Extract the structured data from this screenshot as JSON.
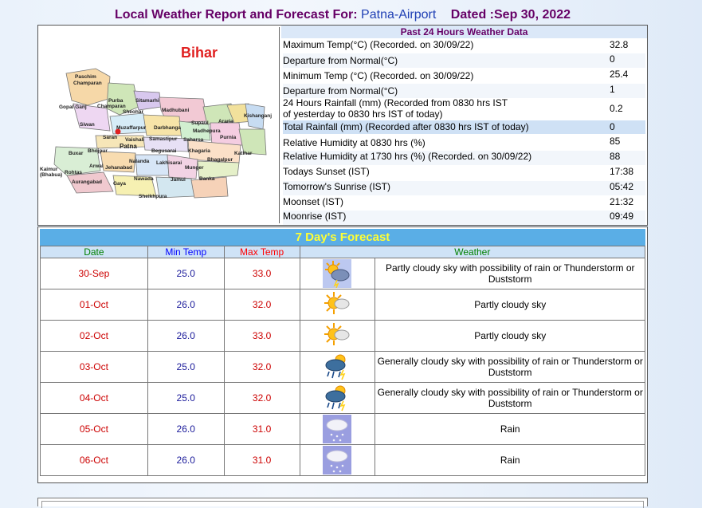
{
  "header": {
    "prefix": "Local Weather Report and Forecast For:",
    "station": "Patna-Airport",
    "dated": "Dated :Sep 30, 2022"
  },
  "map": {
    "state": "Bihar",
    "districts": [
      "Paschim Champaran",
      "Purba Champaran",
      "Sitamarhi",
      "Gopal Ganj",
      "Sheohar",
      "Madhubani",
      "Supaul",
      "Araria",
      "Kishanganj",
      "Siwan",
      "Muzaffarpur",
      "Darbhanga",
      "Madhepura",
      "Saran",
      "Vaishali",
      "Samastipur",
      "Saharsa",
      "Purnia",
      "Katihar",
      "Buxar",
      "Bhojpur",
      "Patna",
      "Begusarai",
      "Khagaria",
      "Arwal",
      "Jehanabad",
      "Nalanda",
      "Lakhisarai",
      "Munger",
      "Bhagalpur",
      "Kaimur (Bhabua)",
      "Rohtas",
      "Aurangabad",
      "Gaya",
      "Nawada",
      "Jamui",
      "Banka",
      "Sheikhpura"
    ]
  },
  "past24": {
    "heading": "Past 24 Hours Weather Data",
    "rows": [
      {
        "label": "Maximum Temp(°C) (Recorded. on 30/09/22)",
        "value": "32.8"
      },
      {
        "label": "Departure from Normal(°C)",
        "value": "0"
      },
      {
        "label": "Minimum Temp (°C) (Recorded. on 30/09/22)",
        "value": "25.4"
      },
      {
        "label": "Departure from Normal(°C)",
        "value": "1"
      },
      {
        "label": "24 Hours Rainfall (mm) (Recorded from 0830 hrs IST",
        "label2": "of yesterday to 0830 hrs IST of today)",
        "value": "0.2"
      },
      {
        "label": "Total Rainfall (mm) (Recorded after 0830 hrs IST of today)",
        "value": "0"
      },
      {
        "label": "Relative Humidity at 0830 hrs (%)",
        "value": "85"
      },
      {
        "label": "Relative Humidity at 1730 hrs (%) (Recorded. on 30/09/22)",
        "value": "88"
      },
      {
        "label": "Todays Sunset (IST)",
        "value": "17:38"
      },
      {
        "label": "Tomorrow's Sunrise (IST)",
        "value": "05:42"
      },
      {
        "label": "Moonset (IST)",
        "value": "21:32"
      },
      {
        "label": "Moonrise (IST)",
        "value": "09:49"
      }
    ]
  },
  "forecast": {
    "heading": "7 Day's Forecast",
    "columns": {
      "date": "Date",
      "min": "Min Temp",
      "max": "Max Temp",
      "weather": "Weather"
    },
    "colors": {
      "date": "#008000",
      "min": "#0000ff",
      "max": "#ff0000",
      "weather": "#008000"
    },
    "days": [
      {
        "date": "30-Sep",
        "min": "25.0",
        "max": "33.0",
        "icon": "partly-cloudy-thunder-icon",
        "weather": "Partly cloudy sky with possibility of rain or Thunderstorm or Duststorm"
      },
      {
        "date": "01-Oct",
        "min": "26.0",
        "max": "32.0",
        "icon": "sun-cloud-icon",
        "weather": "Partly cloudy sky"
      },
      {
        "date": "02-Oct",
        "min": "26.0",
        "max": "33.0",
        "icon": "sun-cloud-icon",
        "weather": "Partly cloudy sky"
      },
      {
        "date": "03-Oct",
        "min": "25.0",
        "max": "32.0",
        "icon": "cloud-thunder-rain-icon",
        "weather": "Generally cloudy sky with possibility of rain or Thunderstorm or Duststorm"
      },
      {
        "date": "04-Oct",
        "min": "25.0",
        "max": "32.0",
        "icon": "cloud-thunder-rain-icon",
        "weather": "Generally cloudy sky with possibility of rain or Thunderstorm or Duststorm"
      },
      {
        "date": "05-Oct",
        "min": "26.0",
        "max": "31.0",
        "icon": "rain-icon",
        "weather": "Rain"
      },
      {
        "date": "06-Oct",
        "min": "26.0",
        "max": "31.0",
        "icon": "rain-icon",
        "weather": "Rain"
      }
    ]
  }
}
